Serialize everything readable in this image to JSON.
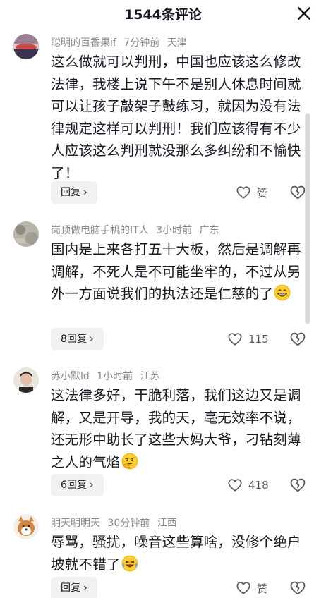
{
  "header": {
    "title": "1544条评论"
  },
  "comments": [
    {
      "user": "聪明的百香果if",
      "time": "7分钟前",
      "location": "天津",
      "text": "这么做就可以判刑，中国也应该这么修改法律，我楼上说下午不是别人休息时间就可以让孩子敲架子鼓练习，就因为没有法律规定这样可以判刑！我们应该得有不少人应该这么判刑就没那么多纠纷和不愉快了！",
      "reply_label": "回复",
      "likes": "赞",
      "avatar_colors": [
        "#7a5c6e",
        "#c94e4a",
        "#3b3450"
      ]
    },
    {
      "user": "岗顶做电脑手机的IT人",
      "time": "3小时前",
      "location": "广东",
      "text": "国内是上来各打五十大板，然后是调解再调解，不死人是不可能坐牢的，不过从另外一方面说我们的执法还是仁慈的了",
      "reply_label": "8回复",
      "likes": "115",
      "emoji": "grin-emoji",
      "avatar_colors": [
        "#9d9a8f",
        "#6f6c63",
        "#c7c3b8"
      ]
    },
    {
      "user": "苏小默ld",
      "time": "1小时前",
      "location": "江苏",
      "text": "这法律多好，干脆利落，我们这边又是调解，又是开导，我的天，毫无效率不说，还无形中助长了这些大妈大爷，刁钻刻薄之人的气焰",
      "reply_label": "6回复",
      "likes": "418",
      "emoji": "thinking-emoji",
      "avatar_colors": [
        "#e9e4de",
        "#2b2623",
        "#c9a48f"
      ]
    },
    {
      "user": "明天明明天",
      "time": "30分钟前",
      "location": "江西",
      "text": "辱骂，骚扰，噪音这些算啥，没修个绝户坡就不错了",
      "reply_label": "回复",
      "likes": "赞",
      "emoji": "laugh-cry-emoji",
      "avatar_colors": [
        "#f2efe9",
        "#d0843d",
        "#ffffff"
      ]
    }
  ]
}
